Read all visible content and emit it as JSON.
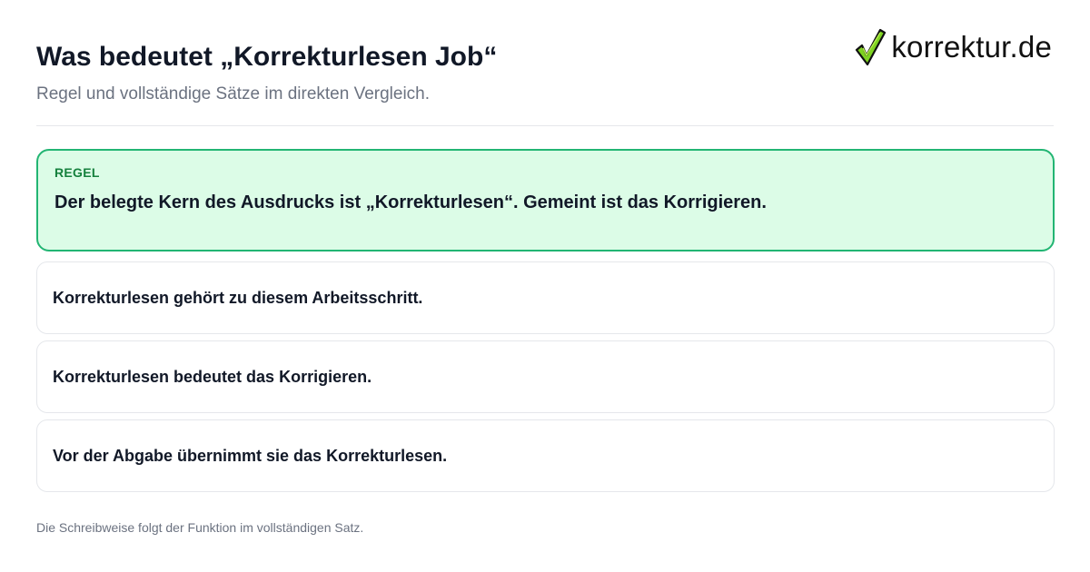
{
  "header": {
    "title": "Was bedeutet „Korrekturlesen Job“",
    "subtitle": "Regel und vollständige Sätze im direkten Vergleich.",
    "logo": {
      "text": "korrektur.de",
      "icon": "check-icon",
      "icon_color": "#7ed321"
    }
  },
  "rule": {
    "label": "REGEL",
    "text": "Der belegte Kern des Ausdrucks ist „Korrekturlesen“. Gemeint ist das Korrigieren.",
    "background_color": "#dcfce7",
    "border_color": "#22b573",
    "label_color": "#15803d"
  },
  "examples": [
    {
      "text": "Korrekturlesen gehört zu diesem Arbeitsschritt."
    },
    {
      "text": "Korrekturlesen bedeutet das Korrigieren."
    },
    {
      "text": "Vor der Abgabe übernimmt sie das Korrekturlesen."
    }
  ],
  "footer": {
    "note": "Die Schreibweise folgt der Funktion im vollständigen Satz."
  }
}
